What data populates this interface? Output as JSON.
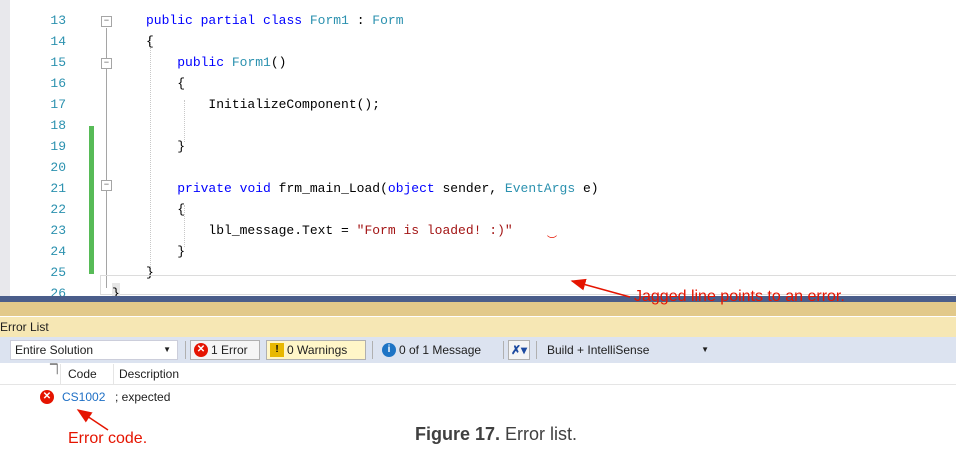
{
  "editor": {
    "lines": [
      {
        "num": "13",
        "html": "<span class='kw'>public</span> <span class='kw'>partial</span> <span class='kw'>class</span> <span class='ty'>Form1</span> : <span class='ty'>Form</span>"
      },
      {
        "num": "14",
        "html": "{"
      },
      {
        "num": "15",
        "html": "    <span class='kw'>public</span> <span class='ty'>Form1</span>()"
      },
      {
        "num": "16",
        "html": "    {"
      },
      {
        "num": "17",
        "html": "        InitializeComponent();"
      },
      {
        "num": "18",
        "html": ""
      },
      {
        "num": "19",
        "html": "    }"
      },
      {
        "num": "20",
        "html": ""
      },
      {
        "num": "21",
        "html": "    <span class='kw'>private</span> <span class='kw'>void</span> frm_main_Load(<span class='kw'>object</span> sender, <span class='ty'>EventArgs</span> e)"
      },
      {
        "num": "22",
        "html": "    {"
      },
      {
        "num": "23",
        "html": "        lbl_message.Text = <span class='st'>\"Form is loaded! :)\"</span>"
      },
      {
        "num": "24",
        "html": "    }"
      },
      {
        "num": "25",
        "html": "}"
      },
      {
        "num": "26",
        "html": ""
      }
    ],
    "closing_brace": "}"
  },
  "error_list": {
    "title": "Error List",
    "scope": "Entire Solution",
    "errors_label": "1 Error",
    "warnings_label": "0 Warnings",
    "messages_label": "0 of 1 Message",
    "build_filter": "Build + IntelliSense",
    "columns": {
      "code": "Code",
      "description": "Description"
    },
    "rows": [
      {
        "code": "CS1002",
        "description": "; expected"
      }
    ]
  },
  "annotations": {
    "error_pointer": "Jagged line points to an error.",
    "code_pointer": "Error code."
  },
  "caption": {
    "label": "Figure 17.",
    "text": "Error list."
  },
  "colors": {
    "keyword": "#0000ff",
    "type": "#2b91af",
    "string": "#a31515",
    "annotation_red": "#e51400",
    "change_bar": "#57bb57"
  }
}
